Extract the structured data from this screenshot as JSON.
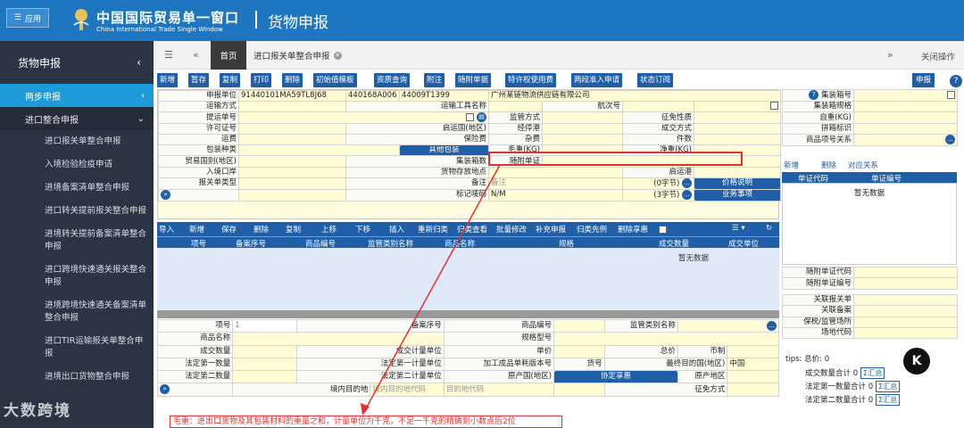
{
  "header": {
    "app_btn": "应用",
    "logo_cn": "中国国际贸易单一窗口",
    "logo_en": "China International Trade Single Window",
    "title": "货物申报"
  },
  "sidebar": {
    "head": "货物申报",
    "groups": [
      {
        "label": "两步申报"
      },
      {
        "label": "进口整合申报"
      }
    ],
    "items": [
      "进口报关单整合申报",
      "入境检验检疫申请",
      "进境备案清单整合申报",
      "进口转关提前报关整合申报",
      "进境转关提前备案清单整合申报",
      "进口跨境快速通关报关整合申报",
      "进境跨境快速通关备案清单整合申报",
      "进口TIR运输报关单整合申报",
      "进境出口货物整合申报"
    ]
  },
  "tabs": {
    "home": "首页",
    "current": "进口报关单整合申报",
    "close_all": "关闭操作"
  },
  "toolbar": [
    "新增",
    "暂存",
    "复制",
    "打印",
    "删除",
    "初始值模板",
    "资质查询",
    "附注",
    "随附单据",
    "特许权使用费",
    "两段准入申请",
    "状态订阅"
  ],
  "declare_btn": "申报",
  "form_a": {
    "r0": [
      "申报单位",
      "91440101MA59TL8J68",
      "440168A006",
      "44009T1399",
      "广州某链物流供应链有限公司"
    ],
    "labels": {
      "transport_mode": "运输方式",
      "transport_name": "运输工具名称",
      "voyage": "航次号",
      "bill_no": "提运单号",
      "supervision": "监管方式",
      "exemption": "征免性质",
      "license": "许可证号",
      "departure_country": "启运国(地区)",
      "port_stop": "经停港",
      "deal_mode": "成交方式",
      "freight": "运费",
      "insurance": "保险费",
      "misc": "杂费",
      "pieces": "件数",
      "package": "包装种类",
      "other_package": "其他包装",
      "gross": "毛重(KG)",
      "net": "净重(KG)",
      "trade_country": "贸易国别(地区)",
      "container_count": "集装箱数",
      "attached": "随附单证",
      "entry_port": "入境口岸",
      "storage": "货物存放地点",
      "dep_port": "启运港",
      "decl_type": "报关单类型",
      "remarks": "备注",
      "remarks_val": "备注",
      "bytes0": "(0字节)",
      "price_btn": "价格说明",
      "marks": "标记唛码",
      "marks_val": "N/M",
      "bytes3": "(3字节)",
      "biz_btn": "业务事项"
    }
  },
  "goods_toolbar": [
    "导入",
    "新增",
    "保存",
    "删除",
    "复制",
    "上移",
    "下移",
    "插入",
    "重新归类",
    "归类查看",
    "批量修改",
    "补充申报",
    "归类先例",
    "删除享惠"
  ],
  "goods_headers": [
    "项号",
    "备案序号",
    "商品编号",
    "监管类别名称",
    "商品名称",
    "规格",
    "成交数量",
    "成交单位"
  ],
  "empty": "暂无数据",
  "form_b": {
    "item_no": "项号",
    "item_no_val": "1",
    "record_no": "备案序号",
    "hs": "商品编号",
    "sup_cat": "监管类别名称",
    "name": "商品名称",
    "spec": "规格型号",
    "qty": "成交数量",
    "unit": "成交计量单位",
    "price": "单价",
    "total": "总价",
    "currency": "币制",
    "q1": "法定第一数量",
    "u1": "法定第一计量单位",
    "process_no": "加工成品单耗版本号",
    "goods_no": "货号",
    "dest_country": "最终目的国(地区)",
    "dest_val": "中国",
    "q2": "法定第二数量",
    "u2": "法定第二计量单位",
    "origin": "原产国(地区)",
    "pref_btn": "协定享惠",
    "origin_region": "原产地区",
    "dom_dest": "境内目的地",
    "dom_dest_ph": "境内目的地代码",
    "dest_code_ph": "目的地代码",
    "exempt_mode": "征免方式"
  },
  "right": {
    "container_no": "集装箱号",
    "container_spec": "集装箱规格",
    "self_weight": "自重(KG)",
    "lcl": "拼箱标识",
    "item_rel": "商品项号关系",
    "tb": [
      "新增",
      "删除",
      "对应关系"
    ],
    "hd": [
      "单证代码",
      "单证编号"
    ],
    "doc_code": "随附单证代码",
    "doc_no": "随附单证编号",
    "related_decl": "关联报关单",
    "related_record": "关联备案",
    "bonded": "保税/监管场所",
    "site_code": "场地代码",
    "tips": "tips:",
    "total": "总价",
    "total_val": "0",
    "sum1": "成交数量合计",
    "sum2": "法定第一数量合计",
    "sum3": "法定第二数量合计",
    "zero": "0",
    "sum_btn": "Σ汇总"
  },
  "bottom_msg": "毛重：进出口货物及其包装材料的重量之和，计量单位为千克，不足一千克的精确到小数点后2位",
  "watermark": "大数跨境",
  "colors": {
    "primary": "#1f5fa7",
    "header": "#1f76c0",
    "highlight": "#e53030"
  }
}
